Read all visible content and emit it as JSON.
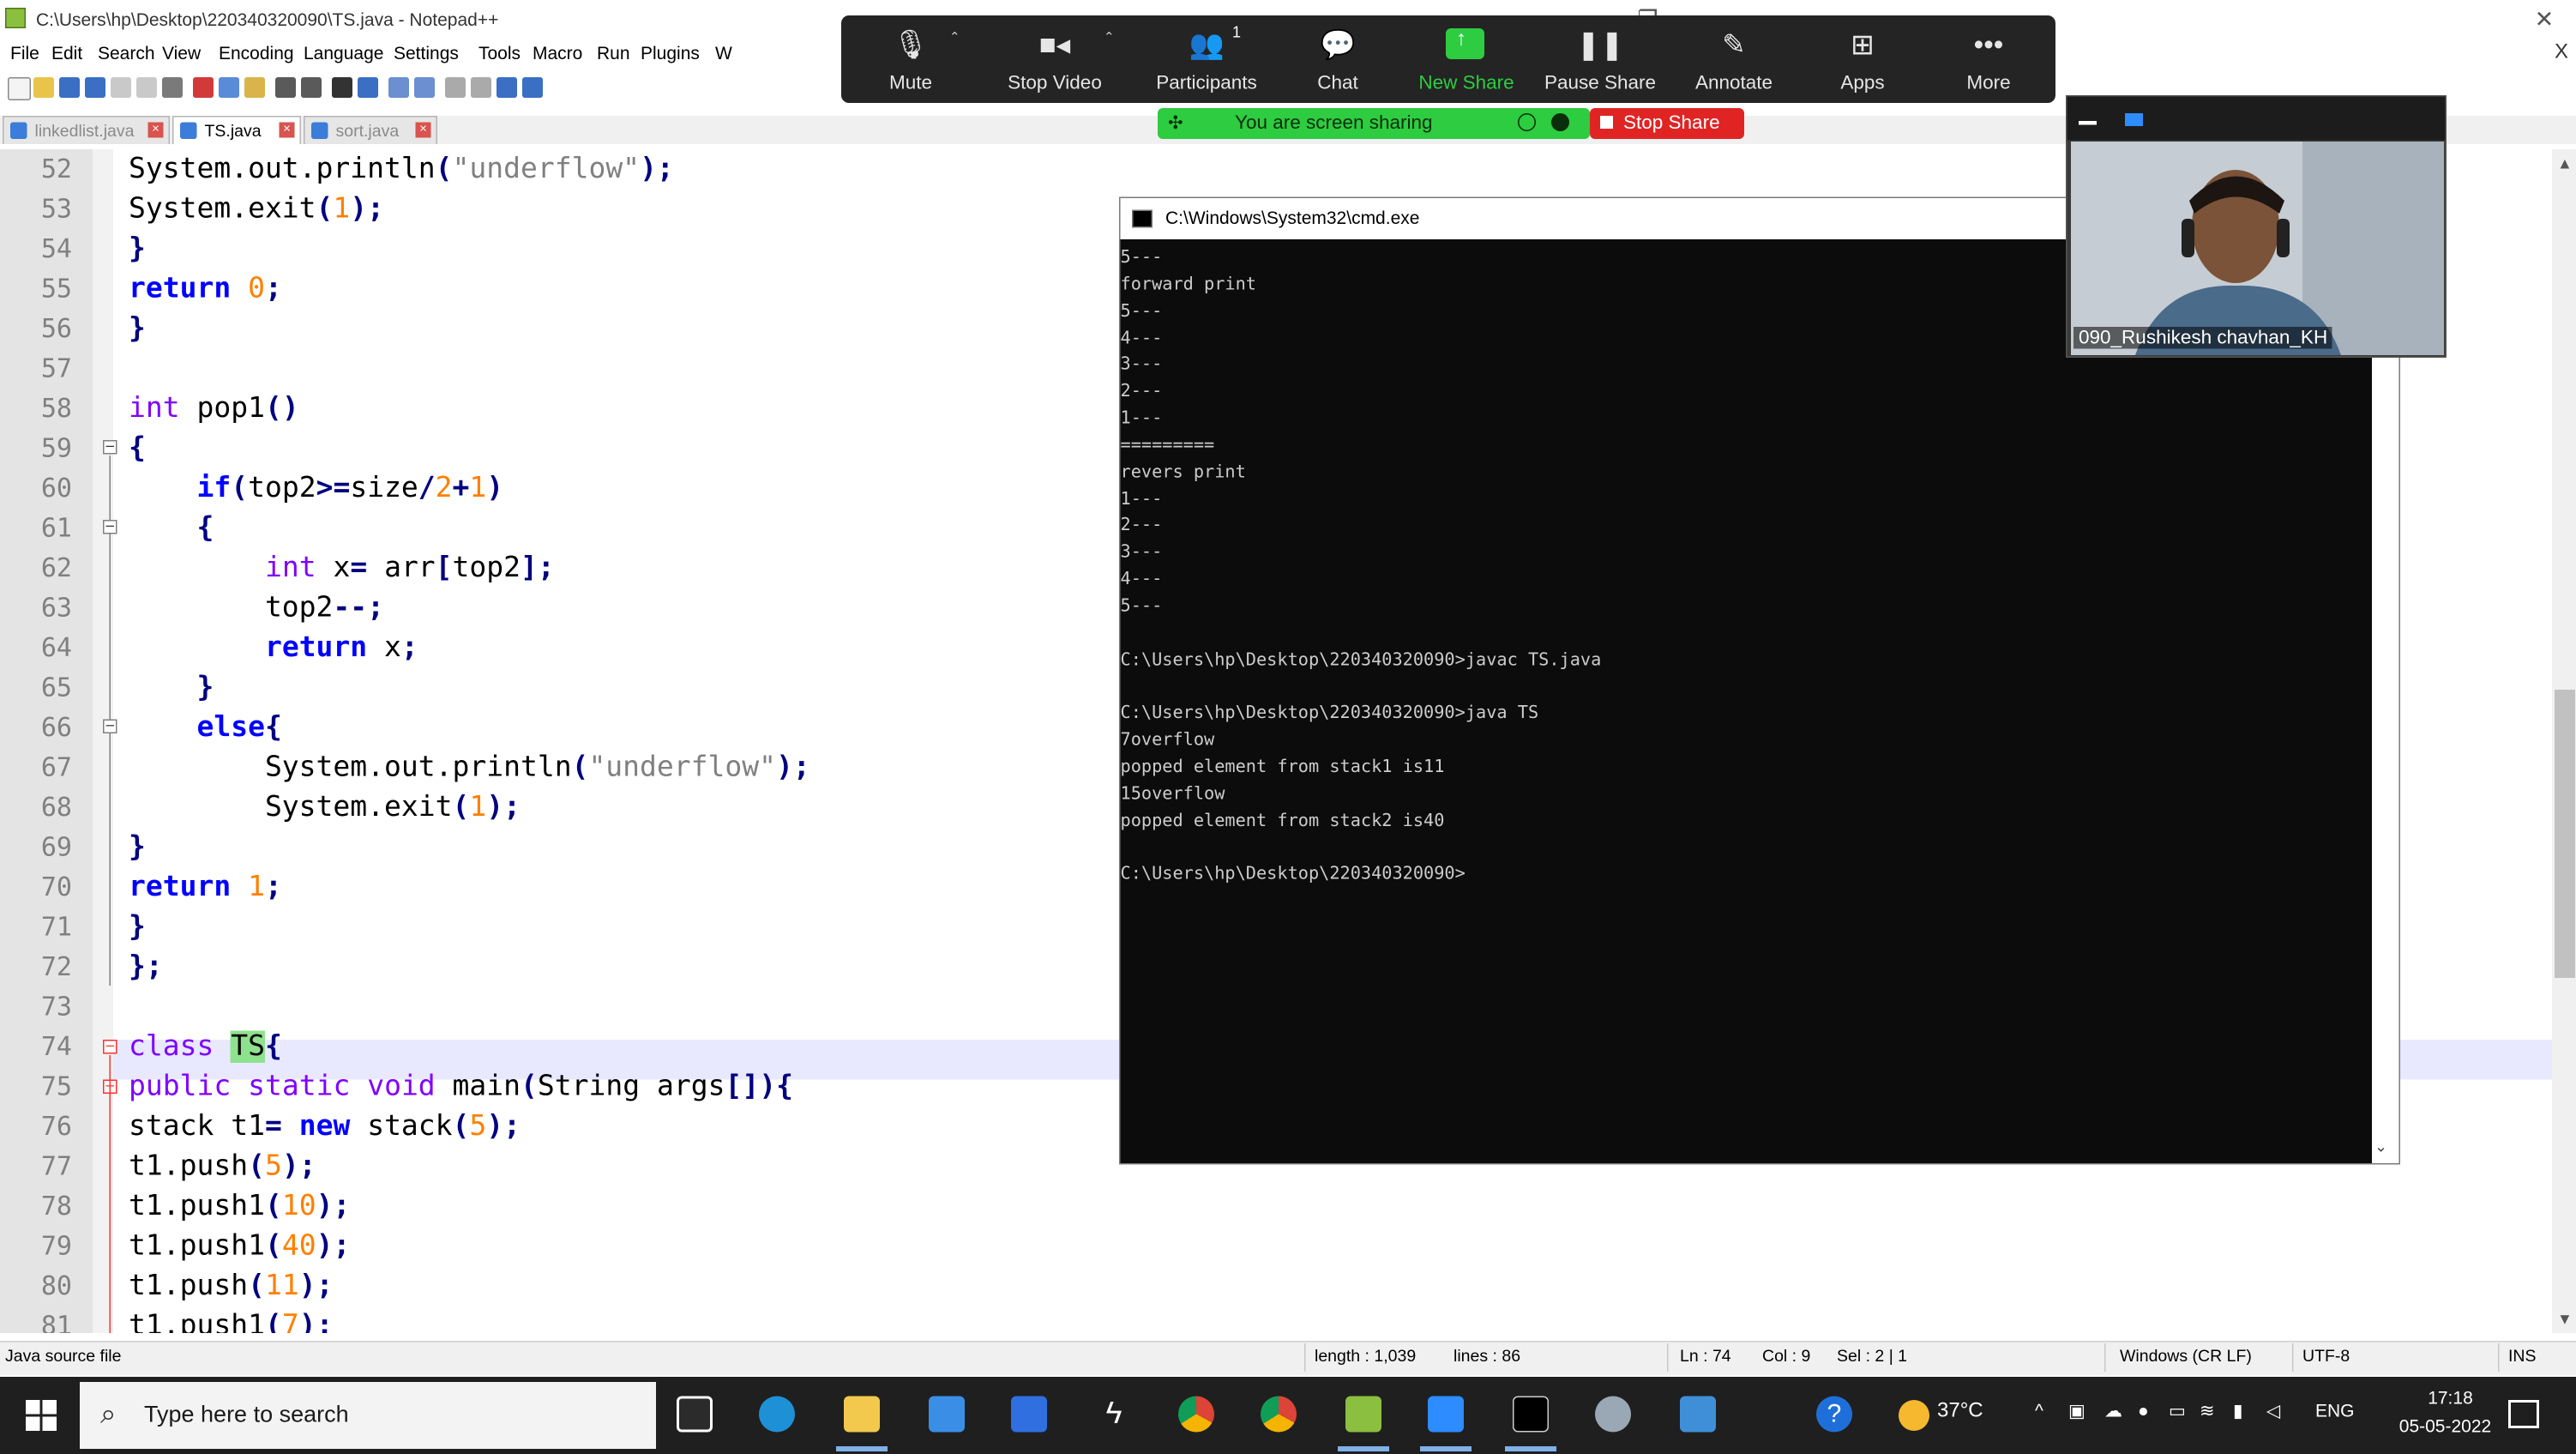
{
  "window": {
    "title": "C:\\Users\\hp\\Desktop\\220340320090\\TS.java - Notepad++",
    "minimize": "–",
    "maximize": "❐",
    "close": "✕",
    "close_document": "X"
  },
  "menu": [
    "File",
    "Edit",
    "Search",
    "View",
    "Encoding",
    "Language",
    "Settings",
    "Tools",
    "Macro",
    "Run",
    "Plugins",
    "W"
  ],
  "tabs": [
    {
      "label": "linkedlist.java",
      "active": false
    },
    {
      "label": "TS.java",
      "active": true
    },
    {
      "label": "sort.java",
      "active": false
    }
  ],
  "editor": {
    "line_numbers": [
      "52",
      "53",
      "54",
      "55",
      "56",
      "57",
      "58",
      "59",
      "60",
      "61",
      "62",
      "63",
      "64",
      "65",
      "66",
      "67",
      "68",
      "69",
      "70",
      "71",
      "72",
      "73",
      "74",
      "75",
      "76",
      "77",
      "78",
      "79",
      "80",
      "81"
    ],
    "lines": [
      "System.out.println(\"underflow\");",
      "System.exit(1);",
      "}",
      "return 0;",
      "}",
      "",
      "int pop1()",
      "{",
      "    if(top2>=size/2+1)",
      "    {",
      "        int x= arr[top2];",
      "        top2--;",
      "        return x;",
      "    }",
      "    else{",
      "        System.out.println(\"underflow\");",
      "        System.exit(1);",
      "}",
      "return 1;",
      "}",
      "};",
      "",
      "class TS{",
      "public static void main(String args[]){",
      "stack t1= new stack(5);",
      "t1.push(5);",
      "t1.push1(10);",
      "t1.push1(40);",
      "t1.push(11);",
      "t1.push1(7);"
    ],
    "current_line": "74",
    "highlighted_word": "TS"
  },
  "status_bar": {
    "file_type": "Java source file",
    "length": "length : 1,039",
    "lines": "lines : 86",
    "ln": "Ln : 74",
    "col": "Col : 9",
    "sel": "Sel : 2 | 1",
    "eol": "Windows (CR LF)",
    "encoding": "UTF-8",
    "mode": "INS"
  },
  "cmd": {
    "title": "C:\\Windows\\System32\\cmd.exe",
    "output": "5---\nforward print\n5---\n4---\n3---\n2---\n1---\n=========\nrevers print\n1---\n2---\n3---\n4---\n5---\n\nC:\\Users\\hp\\Desktop\\220340320090>javac TS.java\n\nC:\\Users\\hp\\Desktop\\220340320090>java TS\n7overflow\npopped element from stack1 is11\n15overflow\npopped element from stack2 is40\n\nC:\\Users\\hp\\Desktop\\220340320090>"
  },
  "zoom": {
    "buttons": [
      {
        "label": "Mute",
        "icon": "microphone-icon"
      },
      {
        "label": "Stop Video",
        "icon": "video-camera-icon"
      },
      {
        "label": "Participants",
        "icon": "participants-icon",
        "count": "1"
      },
      {
        "label": "Chat",
        "icon": "chat-bubble-icon"
      },
      {
        "label": "New Share",
        "icon": "share-screen-icon"
      },
      {
        "label": "Pause Share",
        "icon": "pause-icon"
      },
      {
        "label": "Annotate",
        "icon": "pencil-icon"
      },
      {
        "label": "Apps",
        "icon": "apps-icon"
      },
      {
        "label": "More",
        "icon": "more-dots-icon"
      }
    ],
    "sharing_banner": "You are screen sharing",
    "stop_share": "Stop Share",
    "participant_name": "090_Rushikesh chavhan_KH"
  },
  "taskbar": {
    "search_placeholder": "Type here to search",
    "weather": "37°C",
    "language": "ENG",
    "time": "17:18",
    "date": "05-05-2022"
  },
  "colors": {
    "keyword": "#0000ff",
    "type": "#8000ff",
    "number": "#ff8000",
    "string": "#808080",
    "zoom_green": "#2ecc40",
    "zoom_red": "#e02424"
  }
}
